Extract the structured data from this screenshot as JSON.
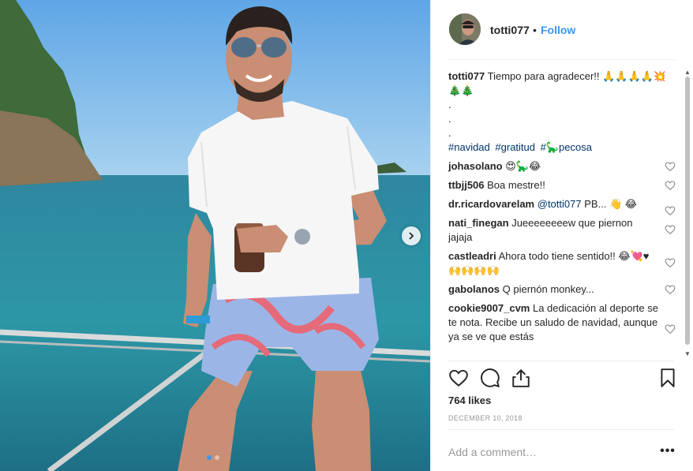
{
  "post": {
    "username": "totti077",
    "follow_label": "Follow",
    "header_dot": "•",
    "caption_text": "Tiempo para agradecer!! 🙏🙏🙏🙏💥🎄🎄",
    "caption_dots": [
      ".",
      ".",
      "."
    ],
    "hashtags": [
      "#navidad",
      "#gratitud",
      "#🦕pecosa"
    ],
    "likes": "764 likes",
    "date": "DECEMBER 10, 2018",
    "add_comment_placeholder": "Add a comment…",
    "more_label": "•••"
  },
  "comments": [
    {
      "user": "johasolano",
      "text": "😍🦕😂"
    },
    {
      "user": "ttbjj506",
      "text": "Boa mestre!!"
    },
    {
      "user": "dr.ricardovarelam",
      "mention": "@totti077",
      "text": " PB... 👋 😂"
    },
    {
      "user": "nati_finegan",
      "text": "Jueeeeeeeew que piernon jajaja"
    },
    {
      "user": "castleadri",
      "text": "Ahora todo tiene sentido!! 😂💘♥🙌🙌🙌🙌"
    },
    {
      "user": "gabolanos",
      "text": "Q piernón monkey..."
    },
    {
      "user": "cookie9007_cvm",
      "text": "La dedicación al deporte se te nota. Recibe un saludo de navidad, aunque ya se ve que estás"
    }
  ],
  "icons": [
    "heart-icon",
    "comment-icon",
    "share-icon",
    "bookmark-icon",
    "chevron-right-icon",
    "small-heart-icon"
  ],
  "colors": {
    "accent": "#3897f0",
    "hashtag": "#003569",
    "text": "#262626",
    "muted": "#999999",
    "divider": "#efefef"
  },
  "carousel": {
    "current": 1,
    "total": 2
  }
}
